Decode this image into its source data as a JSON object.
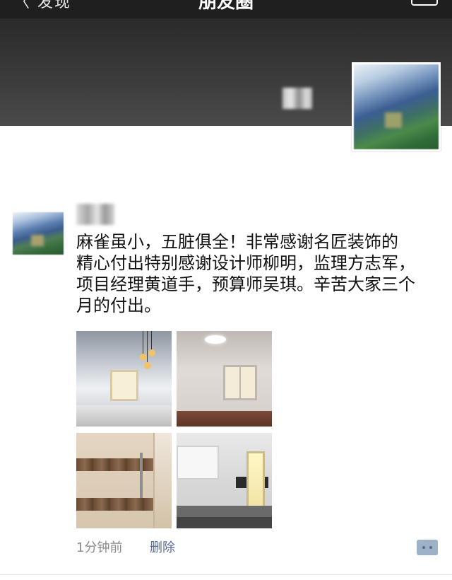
{
  "top_bar": {
    "back_label": "〈 发现",
    "title": "朋友圈",
    "camera_icon": "camera-icon"
  },
  "post": {
    "text_lines": [
      "麻雀虽小，五脏俱全！非常感谢名匠装饰的",
      "精心付出特别感谢设计师柳明，监理方志军，",
      "项目经理黄道手，预算师吴琪。辛苦大家三个",
      "月的付出。"
    ],
    "time": "1分钟前",
    "delete_label": "删除"
  },
  "colors": {
    "link": "#576b95",
    "meta": "#8a8a8a",
    "topbar": "#1f1f1f"
  },
  "icons": {
    "more": "comment-more-icon"
  }
}
